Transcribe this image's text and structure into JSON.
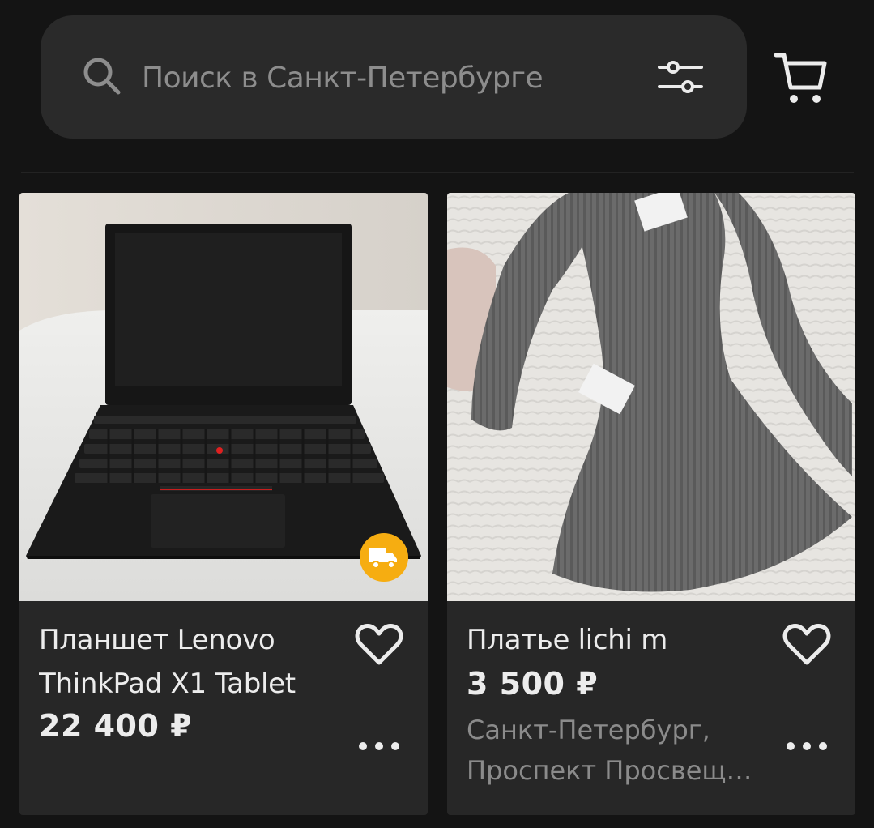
{
  "search": {
    "placeholder": "Поиск в Санкт-Петербурге",
    "icon": "search-icon",
    "filter_icon": "filter-sliders-icon"
  },
  "header": {
    "cart_icon": "cart-icon"
  },
  "colors": {
    "background": "#141414",
    "card": "#272727",
    "search_bar": "#2a2a2a",
    "text": "#ececec",
    "muted": "#8b8b8b",
    "delivery_badge": "#f6ad11"
  },
  "listings": [
    {
      "title_line1": "Планшет Lenovo",
      "title_line2": "ThinkPad X1 Tablet",
      "price": "22 400 ₽",
      "photo": "black tablet with keyboard on white table",
      "badge": "delivery-truck-icon",
      "favorite_icon": "heart-icon",
      "more_icon": "more-dots-icon"
    },
    {
      "title_line1": "Платье lichi m",
      "price": "3 500 ₽",
      "address_line1": "Санкт-Петербург,",
      "address_line2": "Проспект Просвещения",
      "photo": "grey ribbed knit dress on white blanket",
      "favorite_icon": "heart-icon",
      "more_icon": "more-dots-icon"
    }
  ]
}
